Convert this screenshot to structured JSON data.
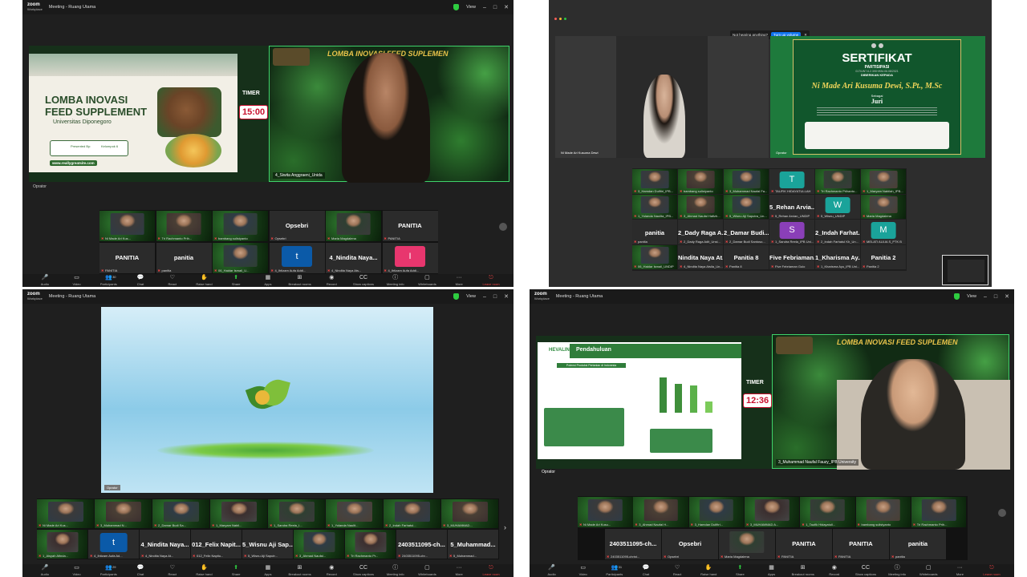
{
  "zoom": {
    "brand": "zoom",
    "product": "Workplace",
    "title": "Meeting - Ruang Utama",
    "view": "View"
  },
  "q1": {
    "slide": {
      "title1": "LOMBA INOVASI",
      "title2": "FEED SUPPLEMENT",
      "university": "Universitas Diponegoro",
      "presented": "Presented By:",
      "group": "Kelompok 6",
      "url": "www.reallygreatsite.com"
    },
    "timer_label": "TIMER",
    "timer": "15:00",
    "banner": "LOMBA INOVASI FEED SUPLEMEN",
    "operator": "Oprator",
    "speaker": "4_Siwita Anggraeni_Unida",
    "thumbs": [
      {
        "big": "",
        "name": "Ni Made Ari Kus..."
      },
      {
        "big": "",
        "name": "Tri Rachmanto Prih..."
      },
      {
        "big": "",
        "name": "bambang sulistyanto"
      },
      {
        "big": "Opsebri",
        "name": "Opsebri"
      },
      {
        "big": "",
        "name": "Maria Magdalena"
      },
      {
        "big": "PANITIA",
        "name": "PANITIA"
      },
      {
        "big": "PANITIA",
        "name": "PANITIA"
      },
      {
        "big": "panitia",
        "name": "panitia"
      },
      {
        "big": "",
        "name": "06_Haidar Ismail_U..."
      },
      {
        "big": "t",
        "name": "4_Ihtizam Aufa Addi..."
      },
      {
        "big": "4_Nindita Naya...",
        "name": "4_Nindita Naya Ats..."
      },
      {
        "big": "I",
        "name": "4_Ihtizam Aufa Addi..."
      }
    ],
    "toolbar": [
      "Audio",
      "Video",
      "Participants",
      "Chat",
      "React",
      "Raise hand",
      "Share",
      "Apps",
      "Breakout rooms",
      "Record",
      "Show captions",
      "Meeting info",
      "Whiteboards",
      "More",
      "Leave room"
    ],
    "participants_count": "30"
  },
  "q2": {
    "notice": "Not hearing anything?",
    "notice_btn": "Turn up volume",
    "left_name": "Ni Made Ari Kusuma Dewi",
    "operator": "Oprator",
    "cert": {
      "title": "SERTIFIKAT",
      "sub": "PARTISIPASI",
      "number": "017/UN7.6.2.3/KH/KM-06.08/2021",
      "given": "DIBERIKAN KEPADA",
      "name": "Ni Made Ari Kusuma Dewi, S.Pt., M.Sc",
      "as": "Sebagai",
      "role": "Juri"
    },
    "thumbs": [
      {
        "big": "",
        "name": "3_Hamdan Dulfitri_IPB..."
      },
      {
        "big": "",
        "name": "bambang sulistyanto"
      },
      {
        "big": "",
        "name": "3_Muhammad Naufal Fa..."
      },
      {
        "big": "T",
        "name": "TAUFIK HIDAYATULLAH"
      },
      {
        "big": "",
        "name": "Tri Rachmanto Prihanto..."
      },
      {
        "big": "",
        "name": "1_Maryam Nabilah_IPB..."
      },
      {
        "big": "",
        "name": "1_Yolanda Naulita_IPB..."
      },
      {
        "big": "",
        "name": "3_Ahmad Naufal Hafizh..."
      },
      {
        "big": "",
        "name": "5_Wisnu Aji Saputra_Un..."
      },
      {
        "big": "5_Rehan Arvia...",
        "name": "5_Rehan Arvian_UNDIP"
      },
      {
        "big": "W",
        "name": "5_Wisnu_UNDIP"
      },
      {
        "big": "",
        "name": "Maria Magdalena"
      },
      {
        "big": "panitia",
        "name": "panitia"
      },
      {
        "big": "2_Dady Raga A...",
        "name": "2_Dady Raga Adit_Unsi..."
      },
      {
        "big": "2_Damar Budi...",
        "name": "2_Damar Budi Santoso..."
      },
      {
        "big": "S",
        "name": "1_Sandra Reela_IPB Uni..."
      },
      {
        "big": "2_Indah Farhat...",
        "name": "2_Indah Farhatul Kh_Un..."
      },
      {
        "big": "M",
        "name": "MELATI AULIA S_PTK B"
      },
      {
        "big": "",
        "name": "06_Haidar Ismail_UNDIP"
      },
      {
        "big": "Nindita Naya At...",
        "name": "4_Nindita Naya Atsila_Un..."
      },
      {
        "big": "Panitia 8",
        "name": "Panitia 8"
      },
      {
        "big": "Five Febriaman...",
        "name": "Five Febriaman Gulo"
      },
      {
        "big": "1_Kharisma Ay...",
        "name": "1_Kharisma Ayu_IPB Uni..."
      },
      {
        "big": "Panitia 2",
        "name": "Panitia 2"
      }
    ]
  },
  "q3": {
    "operator": "Oprator",
    "participants_count": "29",
    "thumbs_row1": [
      {
        "name": "Ni Made Ari Kus..."
      },
      {
        "name": "3_Muhammad N..."
      },
      {
        "name": "2_Damar Budi Sa..."
      },
      {
        "name": "1_Maryam Nabil..."
      },
      {
        "name": "1_Sandra Reela_I..."
      },
      {
        "name": "1_Yolanda Naulit..."
      },
      {
        "name": "2_Indah Farhatul..."
      },
      {
        "name": "3_MUHAMMAD..."
      }
    ],
    "thumbs_row2": [
      {
        "big": "",
        "name": "1_Aisyah Afinda..."
      },
      {
        "big": "t",
        "name": "4_Ihtizam Aufa Ad..."
      },
      {
        "big": "4_Nindita Naya...",
        "name": "4_Nindita Naya At..."
      },
      {
        "big": "012_Felix Napit...",
        "name": "012_Felix Napitu..."
      },
      {
        "big": "5_Wisnu Aji Sap...",
        "name": "5_Wisnu Aji Saputr..."
      },
      {
        "big": "",
        "name": "3_Ahmad Naufal..."
      },
      {
        "big": "",
        "name": "Tri Rachmanto Pr..."
      },
      {
        "big": "2403511095-ch...",
        "name": "2403511095-chr..."
      },
      {
        "big": "5_Muhammad...",
        "name": "5_Muhammad..."
      }
    ]
  },
  "q4": {
    "slide": {
      "brand": "HEVALIN",
      "title": "Pendahuluan",
      "subtitle": "Potensi Produksi Pertanian di Indonesia"
    },
    "timer_label": "TIMER",
    "timer": "12:36",
    "banner": "LOMBA INOVASI FEED SUPLEMEN",
    "operator": "Oprator",
    "speaker": "3_Muhammad Naufal Fauzy_IPB University",
    "participants_count": "31",
    "thumbs_row1": [
      {
        "big": "",
        "name": "Ni Made Ari Kusu..."
      },
      {
        "big": "",
        "name": "3_Ahmad Naufal H..."
      },
      {
        "big": "",
        "name": "3_Hamdan Dulfitri..."
      },
      {
        "big": "",
        "name": "3_MUHAMMAD A..."
      },
      {
        "big": "",
        "name": "1_Taufik Hidayatull..."
      },
      {
        "big": "",
        "name": "bambang sulistyanto"
      },
      {
        "big": "",
        "name": "Tri Rachmanto Prih..."
      }
    ],
    "thumbs_row2": [
      {
        "big": "2403511095-ch...",
        "name": "2403511095-christ..."
      },
      {
        "big": "Opsebri",
        "name": "Opsebri"
      },
      {
        "big": "",
        "name": "Maria Magdalena"
      },
      {
        "big": "PANITIA",
        "name": "PANITIA"
      },
      {
        "big": "PANITIA",
        "name": "PANITIA"
      },
      {
        "big": "panitia",
        "name": "panitia"
      }
    ]
  }
}
